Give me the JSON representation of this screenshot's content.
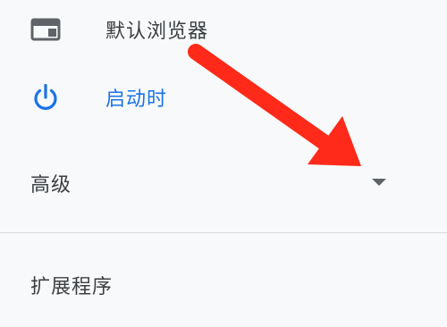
{
  "menu": {
    "default_browser_label": "默认浏览器",
    "on_startup_label": "启动时",
    "advanced_label": "高级",
    "extensions_label": "扩展程序"
  },
  "icons": {
    "default_browser": "browser-window-icon",
    "on_startup": "power-icon",
    "advanced_toggle": "caret-down-icon"
  },
  "colors": {
    "background": "#f8f9fa",
    "text": "#3c4043",
    "accent": "#1a73e8",
    "icon_gray": "#5f6368",
    "divider": "#dadce0",
    "annotation_arrow": "#ff2a1a"
  }
}
